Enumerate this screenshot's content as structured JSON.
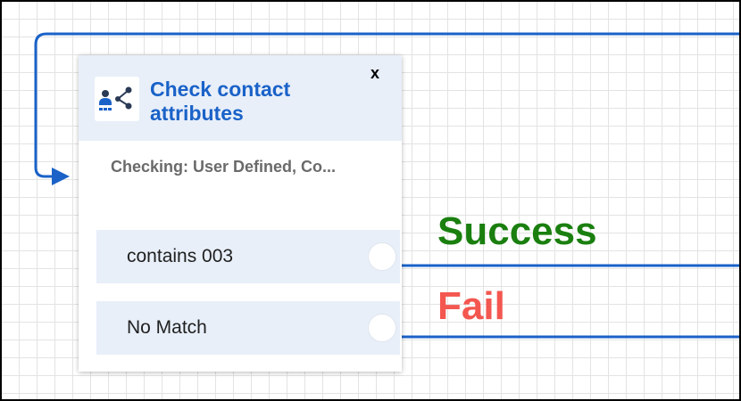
{
  "block": {
    "title": "Check contact attributes",
    "subtitle": "Checking: User Defined, Co...",
    "close_label": "x",
    "icon": "check-contact-attributes-icon",
    "branches": [
      {
        "label": "contains 003"
      },
      {
        "label": "No Match"
      }
    ]
  },
  "annotations": {
    "success": "Success",
    "fail": "Fail"
  },
  "colors": {
    "connector": "#1a62c8",
    "title": "#1a62c8",
    "header_background": "#e8eff9",
    "success": "#1a7f0f",
    "fail": "#f3574f"
  }
}
